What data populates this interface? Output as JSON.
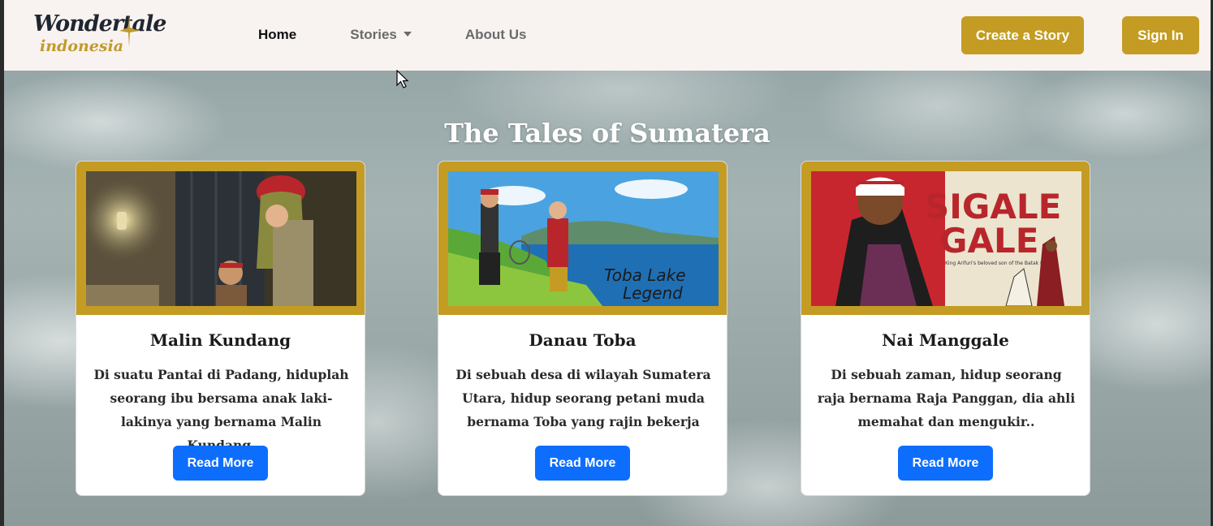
{
  "nav": {
    "logo_text": "Wondertale",
    "logo_sub": "indonesia",
    "links": [
      {
        "label": "Home",
        "active": true
      },
      {
        "label": "Stories",
        "dropdown": true
      },
      {
        "label": "About Us"
      }
    ],
    "create_label": "Create a Story",
    "signin_label": "Sign In"
  },
  "section": {
    "title": "The Tales of Sumatera"
  },
  "cards": [
    {
      "title": "Malin Kundang",
      "text": "Di suatu Pantai di Padang, hiduplah seorang ibu bersama anak laki-lakinya yang bernama Malin Kundang.",
      "button": "Read More"
    },
    {
      "title": "Danau Toba",
      "text": "Di sebuah desa di wilayah Sumatera Utara, hidup seorang petani muda bernama Toba yang rajin bekerja",
      "button": "Read More",
      "image_caption_1": "Toba Lake",
      "image_caption_2": "Legend"
    },
    {
      "title": "Nai Manggale",
      "text": "Di sebuah zaman, hidup seorang raja bernama Raja Panggan, dia ahli memahat dan mengukir..",
      "button": "Read More",
      "image_title_1": "SIGALE",
      "image_title_2": "GALE",
      "image_caption": "King Arifuri's beloved son of the Batak Land"
    }
  ],
  "colors": {
    "gold": "#c49c23",
    "blue": "#0d6efd",
    "navbar_bg": "#f8f3f1"
  }
}
